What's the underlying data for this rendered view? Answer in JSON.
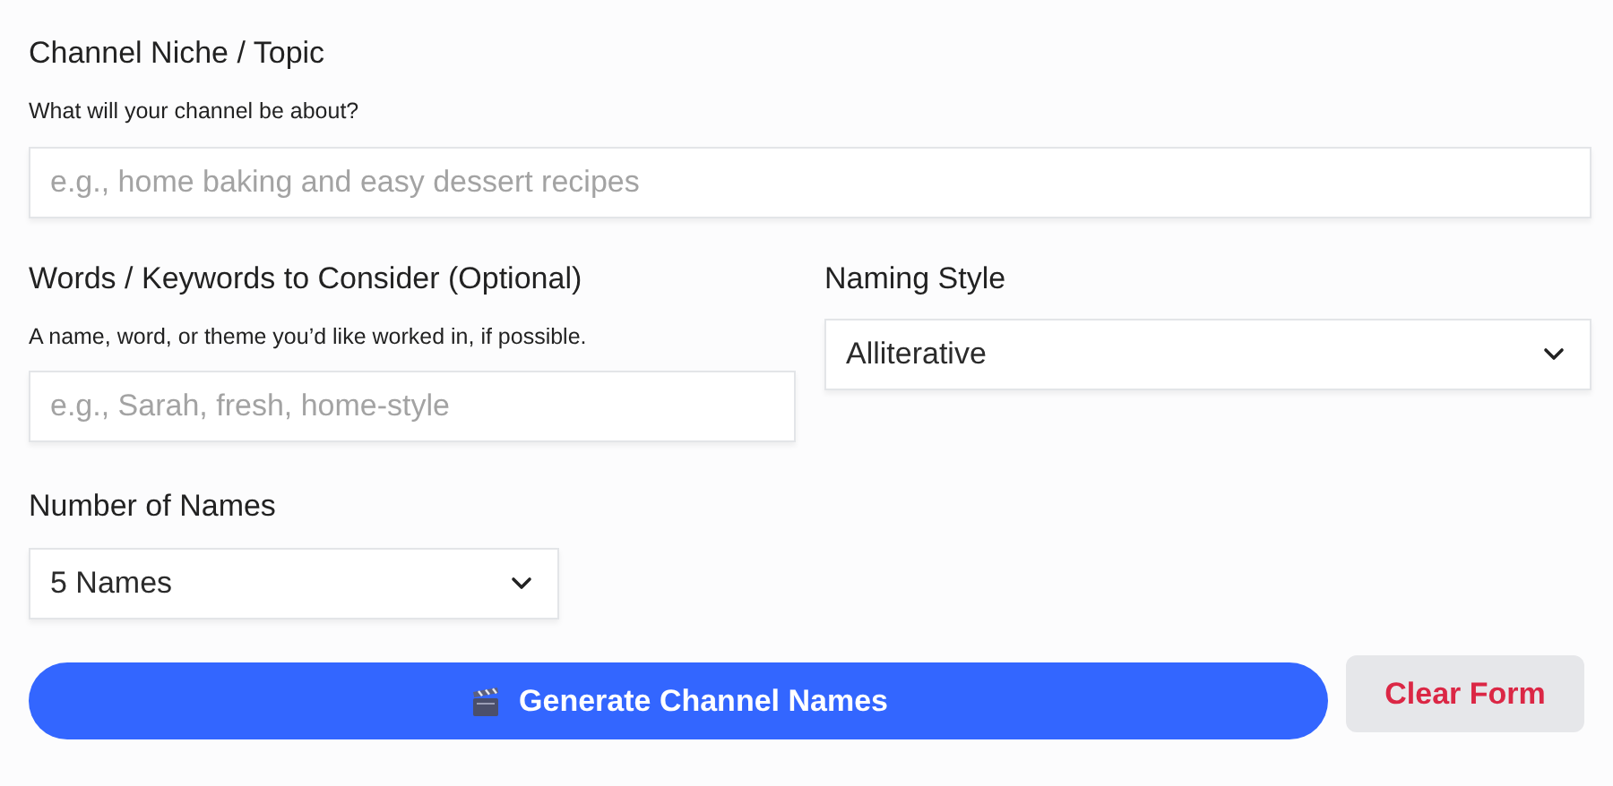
{
  "topic": {
    "label": "Channel Niche / Topic",
    "hint": "What will your channel be about?",
    "placeholder": "e.g., home baking and easy dessert recipes"
  },
  "keywords": {
    "label": "Words / Keywords to Consider (Optional)",
    "hint": "A name, word, or theme you’d like worked in, if possible.",
    "placeholder": "e.g., Sarah, fresh, home-style"
  },
  "naming_style": {
    "label": "Naming Style",
    "value": "Alliterative"
  },
  "count": {
    "label": "Number of Names",
    "value": "5 Names"
  },
  "buttons": [
    {
      "kind": "primary",
      "label": "Generate Channel Names"
    },
    {
      "kind": "secondary",
      "label": "Clear Form"
    }
  ]
}
